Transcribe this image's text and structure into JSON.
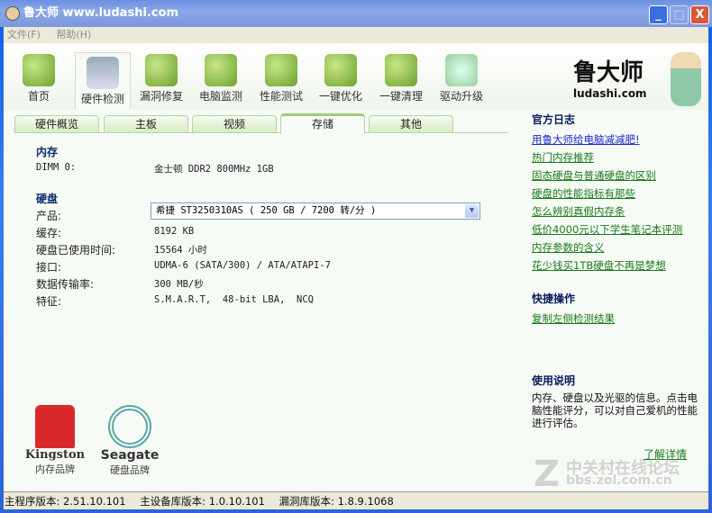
{
  "window": {
    "title": "鲁大师 www.ludashi.com",
    "buttons": [
      "_",
      "□",
      "X"
    ]
  },
  "menu": [
    "文件(F)",
    "帮助(H)"
  ],
  "toolbar": [
    {
      "label": "首页",
      "icon": "home-icon"
    },
    {
      "label": "硬件检测",
      "icon": "computer-icon",
      "active": true
    },
    {
      "label": "漏洞修复",
      "icon": "windows-patch-icon"
    },
    {
      "label": "电脑监测",
      "icon": "monitor-chart-icon"
    },
    {
      "label": "性能测试",
      "icon": "star-search-icon"
    },
    {
      "label": "一键优化",
      "icon": "up-arrow-icon"
    },
    {
      "label": "一键清理",
      "icon": "broom-icon"
    },
    {
      "label": "驱动升级",
      "icon": "wrench-icon"
    }
  ],
  "logo": {
    "text": "鲁大师",
    "url": "ludashi.com"
  },
  "tabs": [
    "硬件概览",
    "主板",
    "视频",
    "存储",
    "其他"
  ],
  "memory": {
    "heading": "内存",
    "label": "DIMM 0:",
    "value": "金士顿 DDR2 800MHz 1GB"
  },
  "disk": {
    "heading": "硬盘",
    "product_label": "产品:",
    "product_value": "希捷 ST3250310AS ( 250 GB / 7200 转/分 )",
    "rows": [
      {
        "label": "缓存:",
        "value": "8192 KB"
      },
      {
        "label": "硬盘已使用时间:",
        "value": "15564 小时"
      },
      {
        "label": "接口:",
        "value": "UDMA-6 (SATA/300) / ATA/ATAPI-7"
      },
      {
        "label": "数据传输率:",
        "value": "300 MB/秒"
      },
      {
        "label": "特征:",
        "value": "S.M.A.R.T,  48-bit LBA,  NCQ"
      }
    ]
  },
  "brands": [
    {
      "logo": "Kingston",
      "caption": "内存品牌"
    },
    {
      "logo": "Seagate",
      "caption": "硬盘品牌"
    }
  ],
  "side": {
    "log_title": "官方日志",
    "links": [
      "用鲁大师给电脑减减肥!",
      "热门内存推荐",
      "固态硬盘与普通硬盘的区别",
      "硬盘的性能指标有那些",
      "怎么辨别真假内存条",
      "低价4000元以下学生笔记本评测",
      "内存参数的含义",
      "花少钱买1TB硬盘不再是梦想"
    ],
    "quick_title": "快捷操作",
    "quick_link": "复制左侧检测结果",
    "help_title": "使用说明",
    "help_text": "内存、硬盘以及光驱的信息。点击电脑性能评分，可以对自己爱机的性能进行评估。",
    "more": "了解详情"
  },
  "watermark": {
    "line1": "中关村在线论坛",
    "line2": "bbs.zol.com.cn"
  },
  "status": [
    "主程序版本: 2.51.10.101",
    "主设备库版本: 1.0.10.101",
    "漏洞库版本: 1.8.9.1068"
  ]
}
